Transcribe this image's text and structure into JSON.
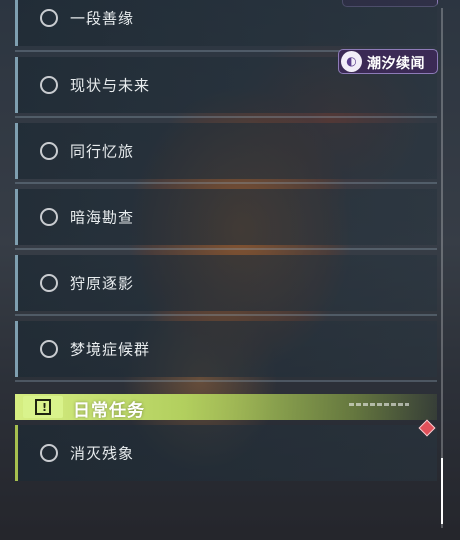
{
  "quests": [
    {
      "label": "一段善缘",
      "completed": false
    },
    {
      "label": "现状与未来",
      "completed": false
    },
    {
      "label": "同行忆旅",
      "completed": false
    },
    {
      "label": "暗海勘查",
      "completed": false
    },
    {
      "label": "狩原逐影",
      "completed": false
    },
    {
      "label": "梦境症候群",
      "completed": false
    }
  ],
  "event_badge": {
    "label": "潮汐续闻",
    "logo_glyph": "◐"
  },
  "daily_section": {
    "title": "日常任务",
    "icon": "exclamation-square-icon",
    "quests": [
      {
        "label": "消灭残象",
        "completed": false
      }
    ]
  },
  "colors": {
    "main_accent": "#7f9fb0",
    "daily_accent": "#a7c04f",
    "header_bg": "#d6ee82",
    "badge_bg": "#3b2a55",
    "alert": "#e0505a"
  }
}
